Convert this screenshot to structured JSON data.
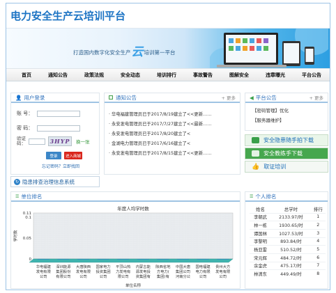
{
  "header": {
    "title": "电力安全生产云培训平台"
  },
  "banner": {
    "slogan_left": "打造国内数字化安全生产",
    "slogan_yun": "云",
    "slogan_right": "培训第一平台"
  },
  "nav": [
    "首页",
    "通知公告",
    "政策法规",
    "安全动态",
    "培训排行",
    "事故警告",
    "图解安全",
    "违章曝光",
    "平台公告"
  ],
  "login": {
    "title": "用户登录",
    "account_label": "账  号：",
    "password_label": "密  码：",
    "captcha_label_1": "验证",
    "captcha_label_2": "码：",
    "captcha_text": "3HYP",
    "refresh_label": "换一张",
    "login_btn": "登录",
    "register_btn": "进入商城",
    "forgot_label": "忘记密码？立即找回"
  },
  "notice": {
    "title": "通知公告",
    "more": "+ 更多",
    "items": [
      "华电福建管理员已于2017/8/19建立了<<更新……",
      "永安发电管理员已于2017/7/27建立了<<最新……",
      "永安发电管理员已于2017/8/20建立了<",
      "金湖电力管理员已于2017/6/16建立了<",
      "永安发电管理员已于2017/8/15建立了<<更新……"
    ]
  },
  "platform": {
    "title": "平台公告",
    "more": "+ 更多",
    "items": [
      "【密码管理】优化",
      "【服务器维护】"
    ]
  },
  "quick_links": [
    "安全隐患随手拍下载",
    "安全教练手下载",
    "取证培训"
  ],
  "hazard_link": "隐患排查治理信息系统",
  "unit_rank": {
    "title": "单位排名",
    "chart_data": {
      "type": "bar",
      "title": "年度人均学时数",
      "xlabel": "单位名称",
      "ylabel": "学时数",
      "ylim": [
        0,
        0.11
      ],
      "yticks": [
        "0",
        "0.05",
        "0.1",
        "0.11"
      ],
      "categories": [
        "华电福建发电有限公司",
        "深圳能源集团股份有限公司",
        "大唐陕西发电有限公司",
        "国家电力投资集团公司",
        "平顶山热力发电有限公司",
        "内蒙古能源发电投资集团有限公司",
        "陕西省地方电力(集团)有限公司",
        "中国大唐集团公司河南分公司",
        "国电福建电力有限公司",
        "贵州大方发电有限公司"
      ],
      "values": [
        0,
        0,
        0,
        0,
        0,
        0,
        0,
        0,
        0,
        0
      ]
    }
  },
  "personal_rank": {
    "title": "个人排名",
    "headers": [
      "姓名",
      "总学时",
      "排行"
    ],
    "rows": [
      [
        "李朝武",
        "2133.97/时",
        "1"
      ],
      [
        "林一栋",
        "1930.65/时",
        "2"
      ],
      [
        "谭国林",
        "1027.53/时",
        "3"
      ],
      [
        "李黎明",
        "893.84/时",
        "4"
      ],
      [
        "杨亚雷",
        "510.52/时",
        "5"
      ],
      [
        "宋元辉",
        "484.72/时",
        "6"
      ],
      [
        "余金虎",
        "475.17/时",
        "7"
      ],
      [
        "林清东",
        "449.49/时",
        "8"
      ]
    ]
  },
  "colors": {
    "brand": "#1d74c4",
    "green": "#3aa04a",
    "red": "#d9261c",
    "btn_blue": "#3b86c7"
  }
}
